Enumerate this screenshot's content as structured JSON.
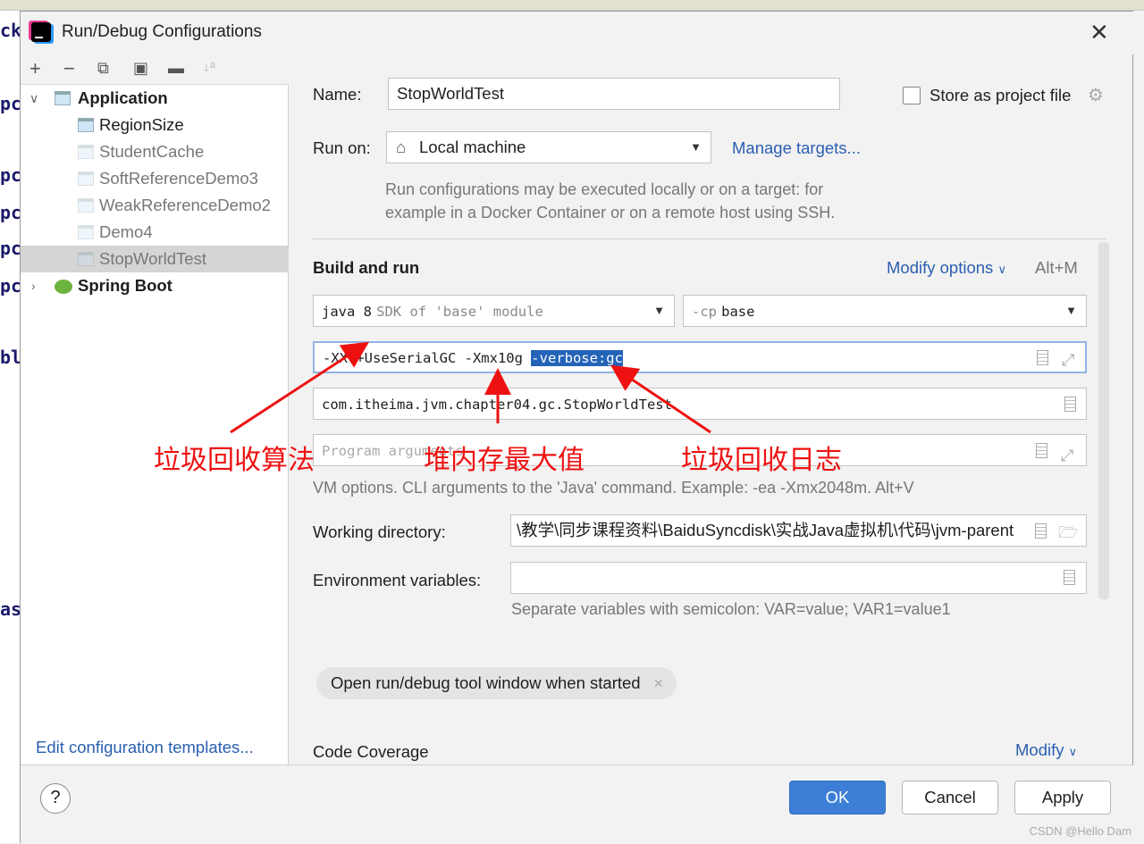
{
  "editor": {
    "fragments": [
      "ck",
      "pc",
      "pc",
      "pc",
      "pc",
      "pc",
      "bl",
      "as"
    ]
  },
  "dialog": {
    "title": "Run/Debug Configurations",
    "close_icon": "close-icon"
  },
  "toolbar": {
    "icons": [
      "add-icon",
      "remove-icon",
      "copy-icon",
      "save-icon",
      "new-folder-icon",
      "sort-icon"
    ]
  },
  "tree": {
    "groups": [
      {
        "label": "Application",
        "expanded": true
      },
      {
        "label": "Spring Boot",
        "expanded": false
      }
    ],
    "items": [
      "RegionSize",
      "StudentCache",
      "SoftReferenceDemo3",
      "WeakReferenceDemo2",
      "Demo4",
      "StopWorldTest"
    ],
    "selected": "StopWorldTest"
  },
  "edit_templates": "Edit configuration templates...",
  "form": {
    "name_label": "Name:",
    "name_value": "StopWorldTest",
    "store_label": "Store as project file",
    "store_checked": false,
    "runon_label": "Run on:",
    "runon_value": "Local machine",
    "manage_targets": "Manage targets...",
    "runon_hint1": "Run configurations may be executed locally or on a target: for",
    "runon_hint2": "example in a Docker Container or on a remote host using SSH.",
    "build_title": "Build and run",
    "modify_options": "Modify options",
    "modify_shortcut": "Alt+M",
    "sdk_main": "java 8",
    "sdk_sub": "SDK of 'base' module",
    "cp_prefix": "-cp",
    "cp_value": "base",
    "vm_options_plain": "-XX:+UseSerialGC -Xmx10g ",
    "vm_options_selected": "-verbose:gc",
    "main_class": "com.itheima.jvm.chapter04.gc.StopWorldTest",
    "program_args_placeholder": "Program arguments",
    "vm_hint": "VM options. CLI arguments to the 'Java' command. Example: -ea -Xmx2048m. Alt+V",
    "workdir_label": "Working directory:",
    "workdir_value": "\\教学\\同步课程资料\\BaiduSyncdisk\\实战Java虚拟机\\代码\\jvm-parent",
    "env_label": "Environment variables:",
    "env_value": "",
    "env_hint": "Separate variables with semicolon: VAR=value; VAR1=value1",
    "chip": "Open run/debug tool window when started",
    "coverage_title": "Code Coverage",
    "coverage_modify": "Modify"
  },
  "annotations": [
    "垃圾回收算法",
    "堆内存最大值",
    "垃圾回收日志"
  ],
  "annotation_color": "#ee1111",
  "buttons": {
    "ok": "OK",
    "cancel": "Cancel",
    "apply": "Apply",
    "help": "?"
  },
  "accent": "#2a5fb0",
  "watermark": "CSDN @Hello Dam"
}
